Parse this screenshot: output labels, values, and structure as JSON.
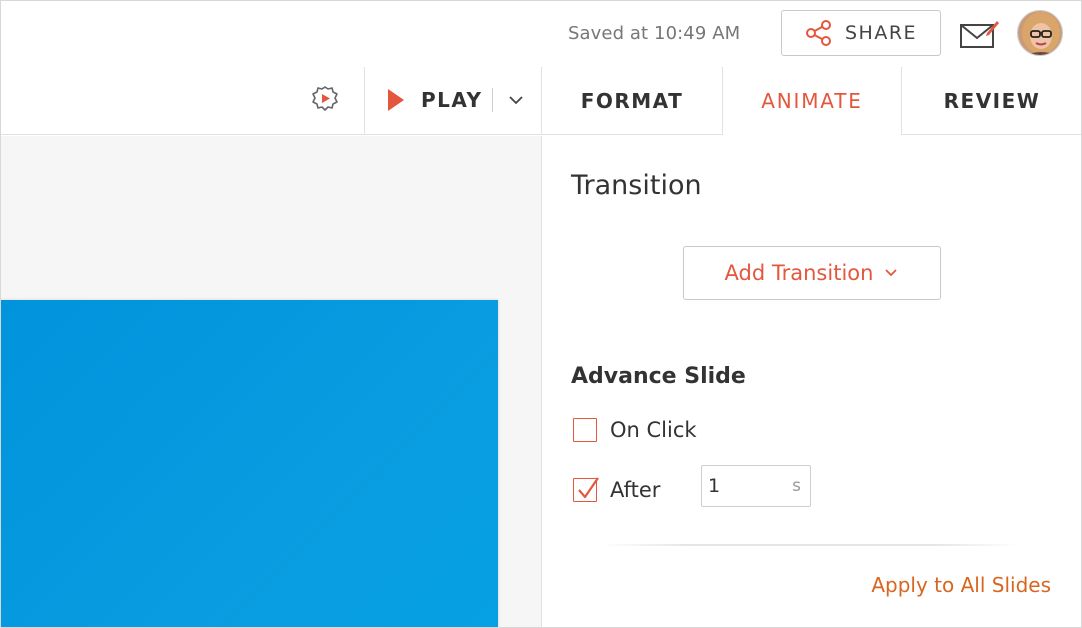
{
  "header": {
    "saved_status": "Saved at 10:49 AM",
    "share_label": "SHARE",
    "icons": {
      "share": "share-icon",
      "mail": "mail-icon",
      "avatar": "user-avatar"
    }
  },
  "toolbar": {
    "play_label": "PLAY",
    "icons": {
      "settings": "settings-gear-icon",
      "play": "play-icon",
      "dropdown": "chevron-down-icon"
    },
    "tabs": [
      {
        "label": "FORMAT",
        "active": false
      },
      {
        "label": "ANIMATE",
        "active": true
      },
      {
        "label": "REVIEW",
        "active": false
      }
    ]
  },
  "slide": {
    "background": "#0193dc"
  },
  "panel": {
    "title": "Transition",
    "add_transition_label": "Add Transition",
    "advance_section_title": "Advance Slide",
    "on_click": {
      "label": "On Click",
      "checked": false
    },
    "after": {
      "label": "After",
      "checked": true,
      "value": "1",
      "unit": "s"
    },
    "apply_all_label": "Apply to All Slides"
  },
  "colors": {
    "accent": "#e4573d",
    "link": "#d9651f",
    "text": "#333333",
    "muted": "#777777",
    "border": "#c9c9c9"
  }
}
